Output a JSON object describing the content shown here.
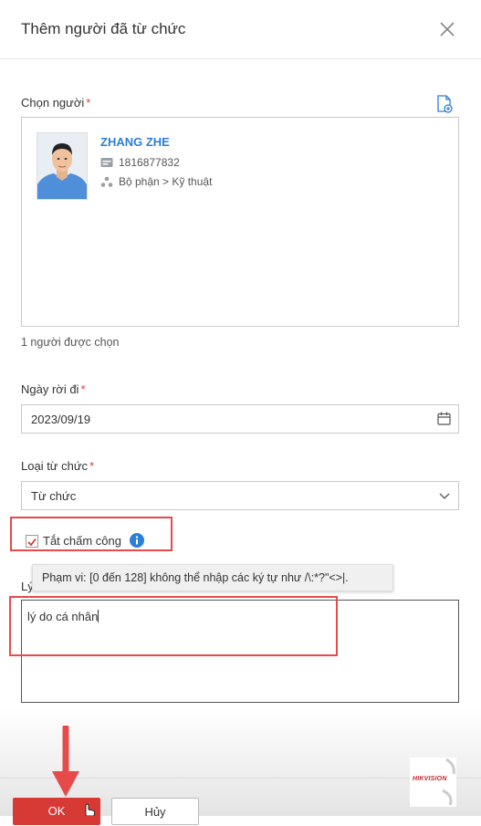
{
  "dialog": {
    "title": "Thêm người đã từ chức"
  },
  "person_picker": {
    "label": "Chọn người",
    "required_mark": "*",
    "selected_count_text": "1 người được chọn",
    "people": [
      {
        "name": "ZHANG ZHE",
        "id_number": "1816877832",
        "department": "Bộ phận > Kỹ thuật"
      }
    ]
  },
  "leave_date": {
    "label": "Ngày rời đi",
    "required_mark": "*",
    "value": "2023/09/19"
  },
  "resignation_type": {
    "label": "Loại từ chức",
    "required_mark": "*",
    "value": "Từ chức"
  },
  "attendance_toggle": {
    "label": "Tắt chấm công",
    "checked": true
  },
  "reason": {
    "label_visible": "Lý",
    "tooltip": "Phạm vi: [0 đến 128] không thể nhập các ký tự như /\\:*?\"<>|.",
    "value": "lý do cá nhân"
  },
  "footer": {
    "ok_label": "OK",
    "cancel_label": "Hủy"
  },
  "watermark": {
    "brand": "HIKVISION"
  },
  "colors": {
    "accent_blue": "#2c7fd6",
    "ok_red": "#d73a34",
    "annotation_red": "#e84a4a",
    "required_red": "#e03c3c"
  },
  "icons": {
    "close": "close-icon",
    "add_person": "add-person-icon",
    "id_card": "id-card-icon",
    "org": "org-icon",
    "calendar": "calendar-icon",
    "chevron": "chevron-down-icon",
    "info": "info-icon"
  }
}
